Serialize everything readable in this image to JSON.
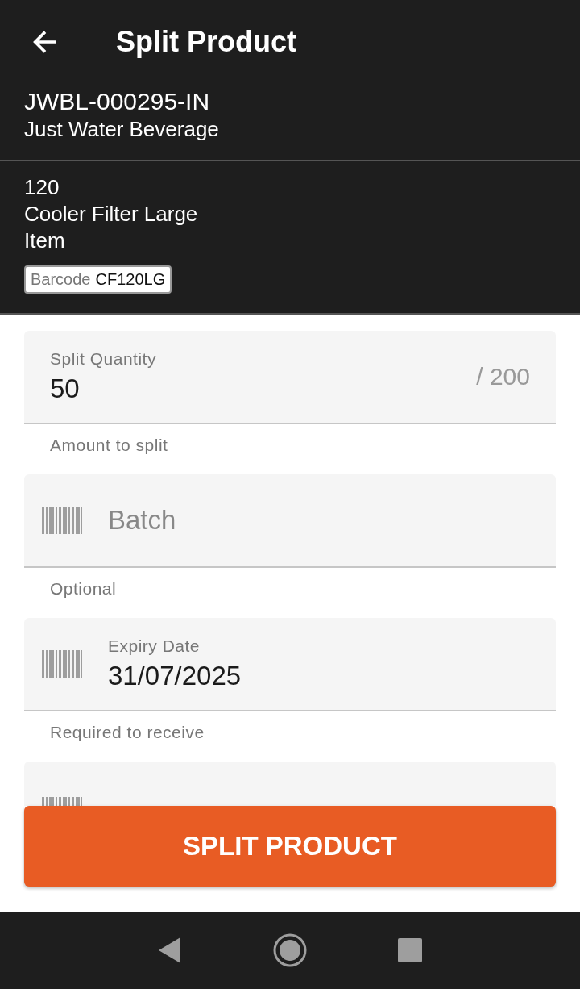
{
  "app_bar": {
    "title": "Split Product"
  },
  "order": {
    "code": "JWBL-000295-IN",
    "customer": "Just Water Beverage"
  },
  "product": {
    "number": "120",
    "name": "Cooler Filter Large",
    "type": "Item",
    "barcode_label": "Barcode",
    "barcode": "CF120LG"
  },
  "fields": [
    {
      "kind": "quantity",
      "label": "Split Quantity",
      "value": "50",
      "suffix": "/ 200",
      "helper": "Amount to split"
    },
    {
      "kind": "scan",
      "placeholder": "Batch",
      "helper": "Optional"
    },
    {
      "kind": "scan",
      "label": "Expiry Date",
      "value": "31/07/2025",
      "helper": "Required to receive"
    },
    {
      "kind": "covered"
    }
  ],
  "button": {
    "label": "SPLIT PRODUCT"
  }
}
